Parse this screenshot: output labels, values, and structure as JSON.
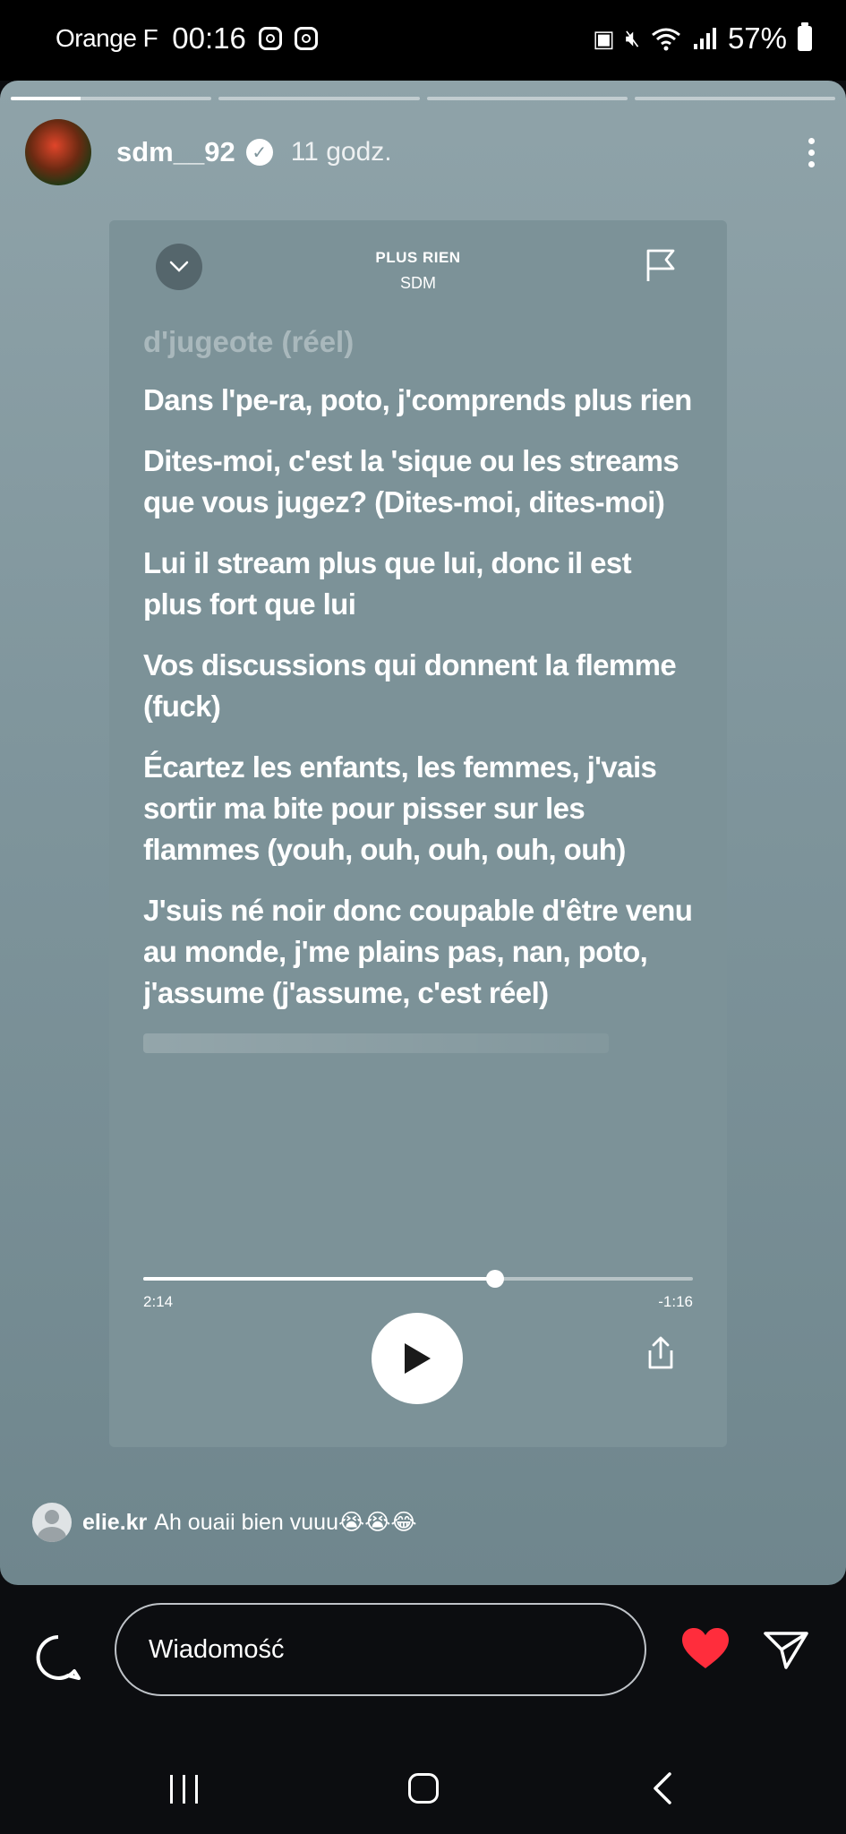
{
  "status_bar": {
    "carrier": "Orange F",
    "time": "00:16",
    "battery": "57%"
  },
  "story": {
    "progress": [
      1,
      0,
      0,
      0
    ],
    "progress_current_fill": 0.35,
    "username": "sdm__92",
    "time_ago": "11 godz."
  },
  "song": {
    "title": "PLUS RIEN",
    "artist": "SDM",
    "faded_line": "d'jugeote (réel)",
    "lines": [
      "Dans l'pe-ra, poto, j'comprends plus rien",
      "Dites-moi, c'est la 'sique ou les streams que vous jugez? (Dites-moi, dites-moi)",
      "Lui il stream plus que lui, donc il est plus fort que lui",
      "Vos discussions qui donnent la flemme (fuck)",
      "Écartez les enfants, les femmes, j'vais sortir ma bite pour pisser sur les flammes (youh, ouh, ouh, ouh, ouh)",
      "J'suis né noir donc coupable d'être venu au monde, j'me plains pas, nan, poto, j'assume (j'assume, c'est réel)"
    ],
    "elapsed": "2:14",
    "remaining": "-1:16",
    "progress": 0.64
  },
  "mention": {
    "user": "elie.kr",
    "text": "Ah ouaii bien vuuu😭😭😂"
  },
  "reply": {
    "placeholder": "Wiadomość"
  },
  "colors": {
    "heart": "#ff2d3c",
    "story_bg": "#7f959c"
  },
  "icons": [
    "instagram-icon",
    "battery-icon",
    "chevron-down-icon",
    "flag-icon",
    "play-icon",
    "share-icon",
    "chat-bubble-icon",
    "heart-icon",
    "send-icon",
    "more-icon",
    "verified-icon"
  ]
}
